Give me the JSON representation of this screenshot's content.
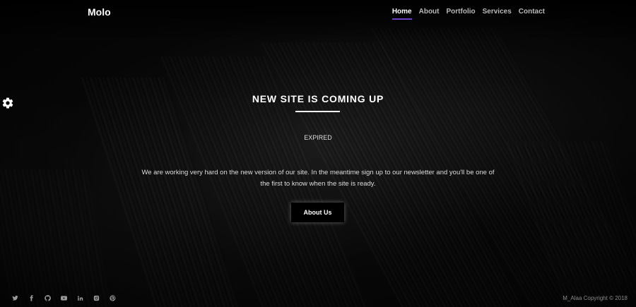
{
  "header": {
    "logo": "Molo",
    "nav": [
      {
        "label": "Home",
        "active": true
      },
      {
        "label": "About",
        "active": false
      },
      {
        "label": "Portfolio",
        "active": false
      },
      {
        "label": "Services",
        "active": false
      },
      {
        "label": "Contact",
        "active": false
      }
    ]
  },
  "hero": {
    "title": "NEW SITE IS COMING UP",
    "status": "EXPIRED",
    "description": "We are working very hard on the new version of our site. In the meantime sign up to our newsletter and you'll be one of the first to know when the site is ready.",
    "button_label": "About Us"
  },
  "settings": {
    "icon": "gear-icon"
  },
  "footer": {
    "social_icons": [
      "twitter-icon",
      "facebook-icon",
      "github-icon",
      "youtube-icon",
      "linkedin-icon",
      "instagram-icon",
      "pinterest-icon"
    ],
    "copyright": "M_Alaa Copyright © 2018"
  },
  "colors": {
    "accent": "#6a3fc4",
    "background": "#050505",
    "text": "#ffffff"
  }
}
